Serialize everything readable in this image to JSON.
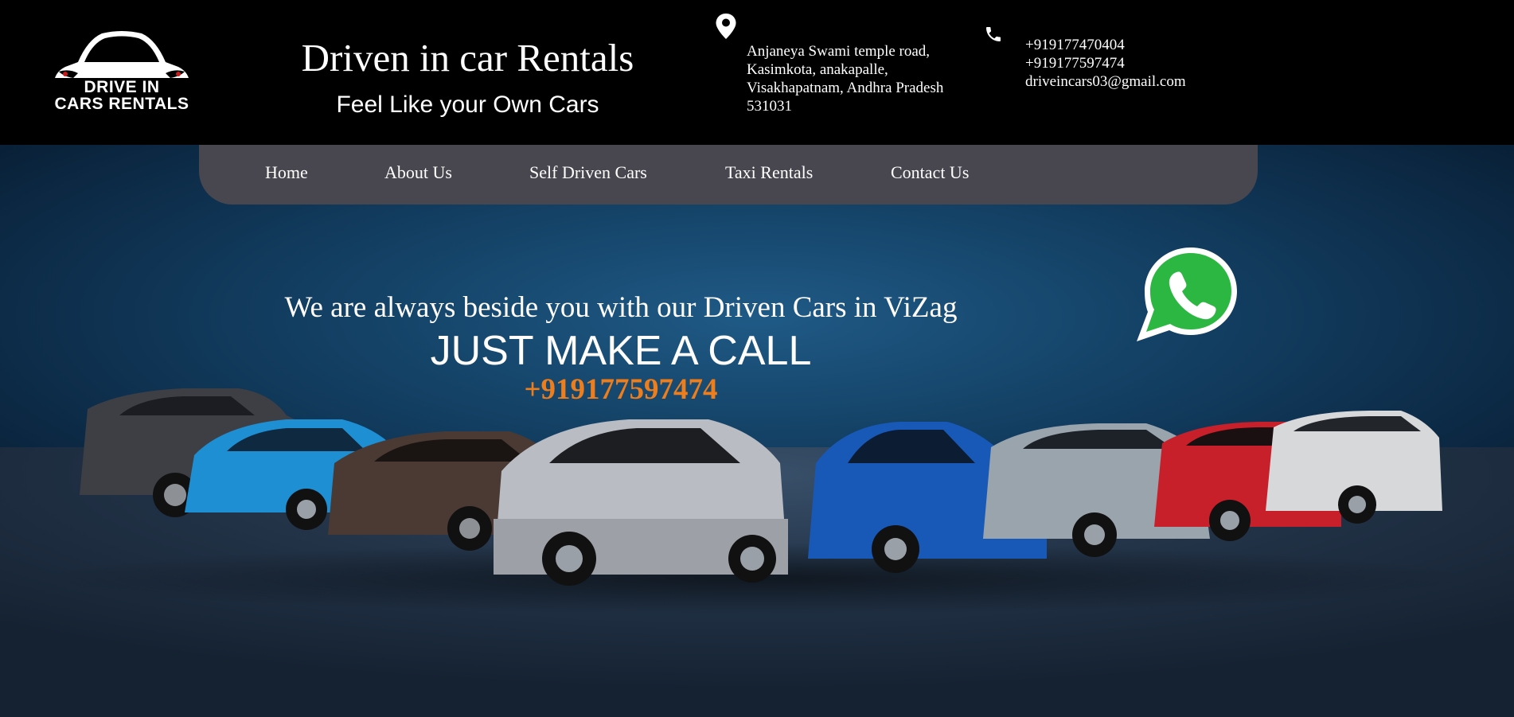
{
  "logo": {
    "line1": "DRIVE IN",
    "line2": "CARS RENTALS"
  },
  "brand": {
    "title": "Driven in car Rentals",
    "tagline": "Feel Like your Own Cars"
  },
  "address": {
    "icon": "location-pin-icon",
    "lines": [
      "Anjaneya Swami temple road,",
      "Kasimkota, anakapalle,",
      "Visakhapatnam, Andhra Pradesh",
      "531031"
    ]
  },
  "contact": {
    "icon": "phone-icon",
    "phone1": "+919177470404",
    "phone2": "+919177597474",
    "email": "driveincars03@gmail.com"
  },
  "nav": {
    "items": [
      {
        "label": "Home"
      },
      {
        "label": "About Us"
      },
      {
        "label": "Self Driven Cars"
      },
      {
        "label": "Taxi Rentals"
      },
      {
        "label": "Contact Us"
      }
    ]
  },
  "hero": {
    "line1": "We are always beside you with our Driven Cars in ViZag",
    "line2": "JUST MAKE A CALL",
    "phone": "+919177597474"
  },
  "whatsapp": {
    "icon": "whatsapp-icon"
  },
  "colors": {
    "accent": "#ee7d1b",
    "nav_bg": "#48474f",
    "header_bg": "#000000",
    "whatsapp_green": "#2bb741"
  }
}
